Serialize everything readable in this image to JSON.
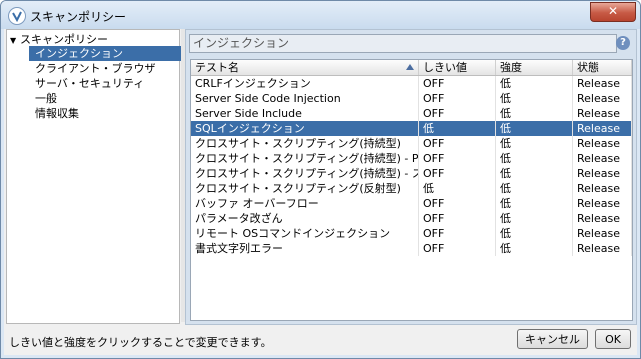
{
  "window": {
    "title": "スキャンポリシー",
    "close_label": "✕"
  },
  "tree": {
    "root_label": "スキャンポリシー",
    "items": [
      {
        "label": "インジェクション"
      },
      {
        "label": "クライアント・ブラウザ"
      },
      {
        "label": "サーバ・セキュリティ"
      },
      {
        "label": "一般"
      },
      {
        "label": "情報収集"
      }
    ]
  },
  "search": {
    "value": "インジェクション"
  },
  "help_label": "?",
  "table": {
    "headers": {
      "name": "テスト名",
      "threshold": "しきい値",
      "strength": "強度",
      "status": "状態"
    },
    "rows": [
      {
        "name": "CRLFインジェクション",
        "threshold": "OFF",
        "strength": "低",
        "status": "Release"
      },
      {
        "name": "Server Side Code Injection",
        "threshold": "OFF",
        "strength": "低",
        "status": "Release"
      },
      {
        "name": "Server Side Include",
        "threshold": "OFF",
        "strength": "低",
        "status": "Release"
      },
      {
        "name": "SQLインジェクション",
        "threshold": "低",
        "strength": "低",
        "status": "Release"
      },
      {
        "name": "クロスサイト・スクリプティング(持続型)",
        "threshold": "OFF",
        "strength": "低",
        "status": "Release"
      },
      {
        "name": "クロスサイト・スクリプティング(持続型) - Pr...",
        "threshold": "OFF",
        "strength": "低",
        "status": "Release"
      },
      {
        "name": "クロスサイト・スクリプティング(持続型) - ス...",
        "threshold": "OFF",
        "strength": "低",
        "status": "Release"
      },
      {
        "name": "クロスサイト・スクリプティング(反射型)",
        "threshold": "低",
        "strength": "低",
        "status": "Release"
      },
      {
        "name": "バッファ オーバーフロー",
        "threshold": "OFF",
        "strength": "低",
        "status": "Release"
      },
      {
        "name": "パラメータ改ざん",
        "threshold": "OFF",
        "strength": "低",
        "status": "Release"
      },
      {
        "name": "リモート OSコマンドインジェクション",
        "threshold": "OFF",
        "strength": "低",
        "status": "Release"
      },
      {
        "name": "書式文字列エラー",
        "threshold": "OFF",
        "strength": "低",
        "status": "Release"
      }
    ]
  },
  "footer": {
    "hint": "しきい値と強度をクリックすることで変更できます。",
    "cancel_label": "キャンセル",
    "ok_label": "OK"
  }
}
